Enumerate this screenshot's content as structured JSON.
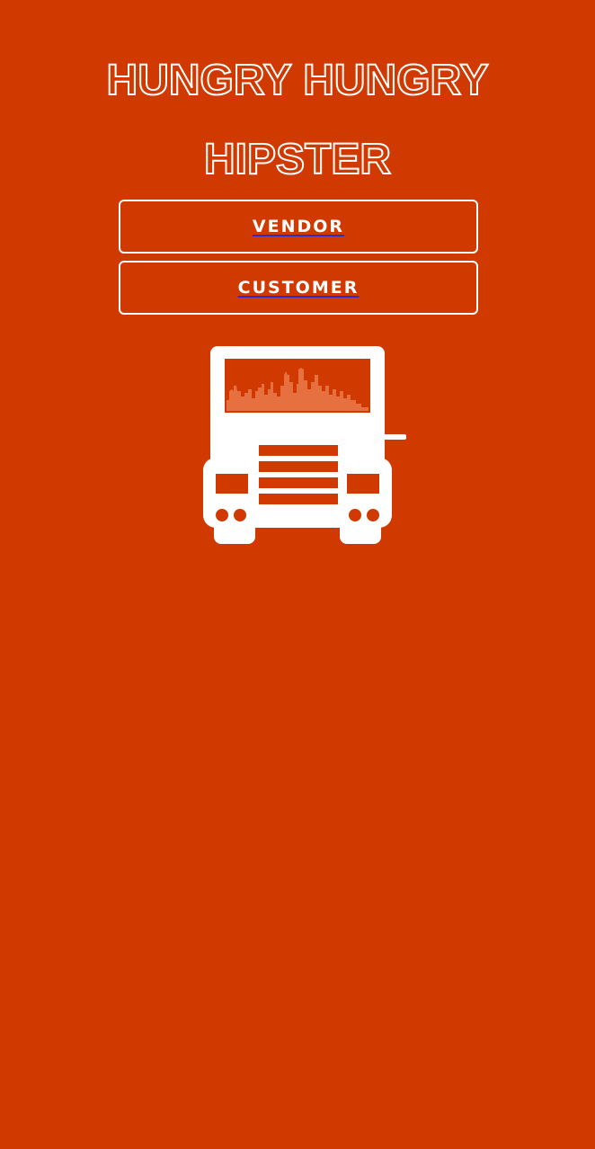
{
  "app": {
    "title_line1": "HUNGRY HUNGRY",
    "title_line2": "HIPSTER"
  },
  "buttons": {
    "vendor_label": "VENDOR",
    "customer_label": "CUSTOMER"
  },
  "logo": {
    "icon": "food-truck-icon"
  },
  "colors": {
    "background": "#d03a00",
    "foreground": "#ffffff",
    "skyline": "#e6703f",
    "link_underline": "#2a2bd6"
  }
}
